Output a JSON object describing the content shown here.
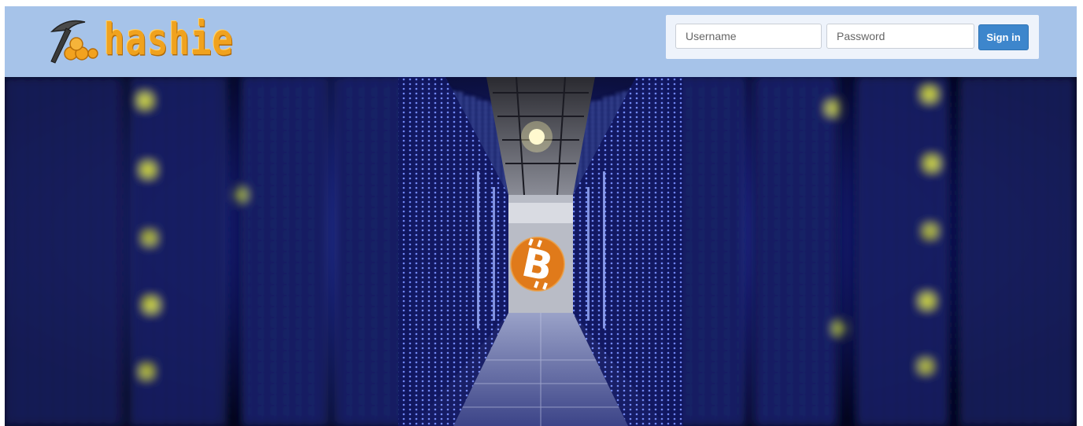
{
  "brand": {
    "name": "hashie"
  },
  "login": {
    "username_placeholder": "Username",
    "password_placeholder": "Password",
    "signin_label": "Sign in"
  },
  "hero": {
    "image": "bitcoin-mining-datacenter",
    "center_icon": "bitcoin-icon"
  },
  "colors": {
    "navbar_bg": "#a6c3e9",
    "accent_button": "#3d86cc",
    "logo_orange": "#f0a21e",
    "bitcoin_orange": "#e07a1a"
  }
}
